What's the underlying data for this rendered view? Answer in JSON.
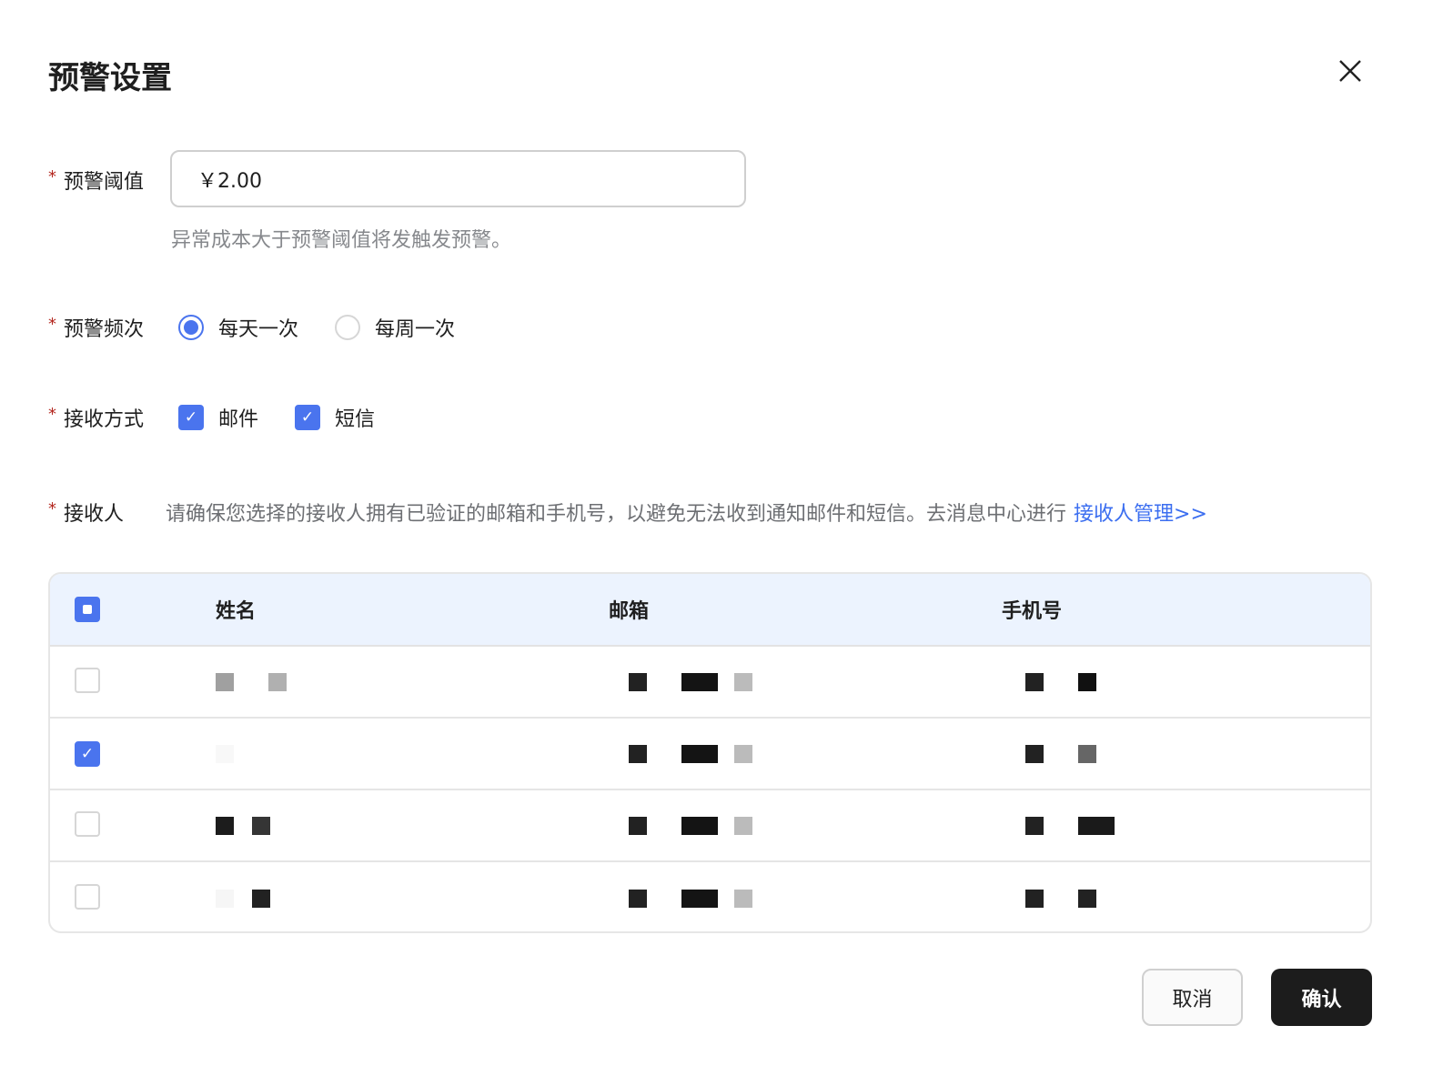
{
  "dialog": {
    "title": "预警设置"
  },
  "threshold": {
    "label": "预警阈值",
    "value": "￥2.00",
    "hint": "异常成本大于预警阈值将发触发预警。"
  },
  "frequency": {
    "label": "预警频次",
    "options": [
      {
        "label": "每天一次",
        "selected": true
      },
      {
        "label": "每周一次",
        "selected": false
      }
    ]
  },
  "method": {
    "label": "接收方式",
    "options": [
      {
        "label": "邮件",
        "checked": true
      },
      {
        "label": "短信",
        "checked": true
      }
    ]
  },
  "recipients": {
    "label": "接收人",
    "note": "请确保您选择的接收人拥有已验证的邮箱和手机号，以避免无法收到通知邮件和短信。去消息中心进行",
    "link": "接收人管理>>"
  },
  "table": {
    "columns": [
      "姓名",
      "邮箱",
      "手机号"
    ],
    "rows_checked": [
      false,
      true,
      false,
      false
    ]
  },
  "actions": {
    "cancel": "取消",
    "confirm": "确认"
  },
  "colors": {
    "accent": "#4a74ee",
    "header_bg": "#ecf3fe",
    "primary_button": "#1c1c1c"
  }
}
